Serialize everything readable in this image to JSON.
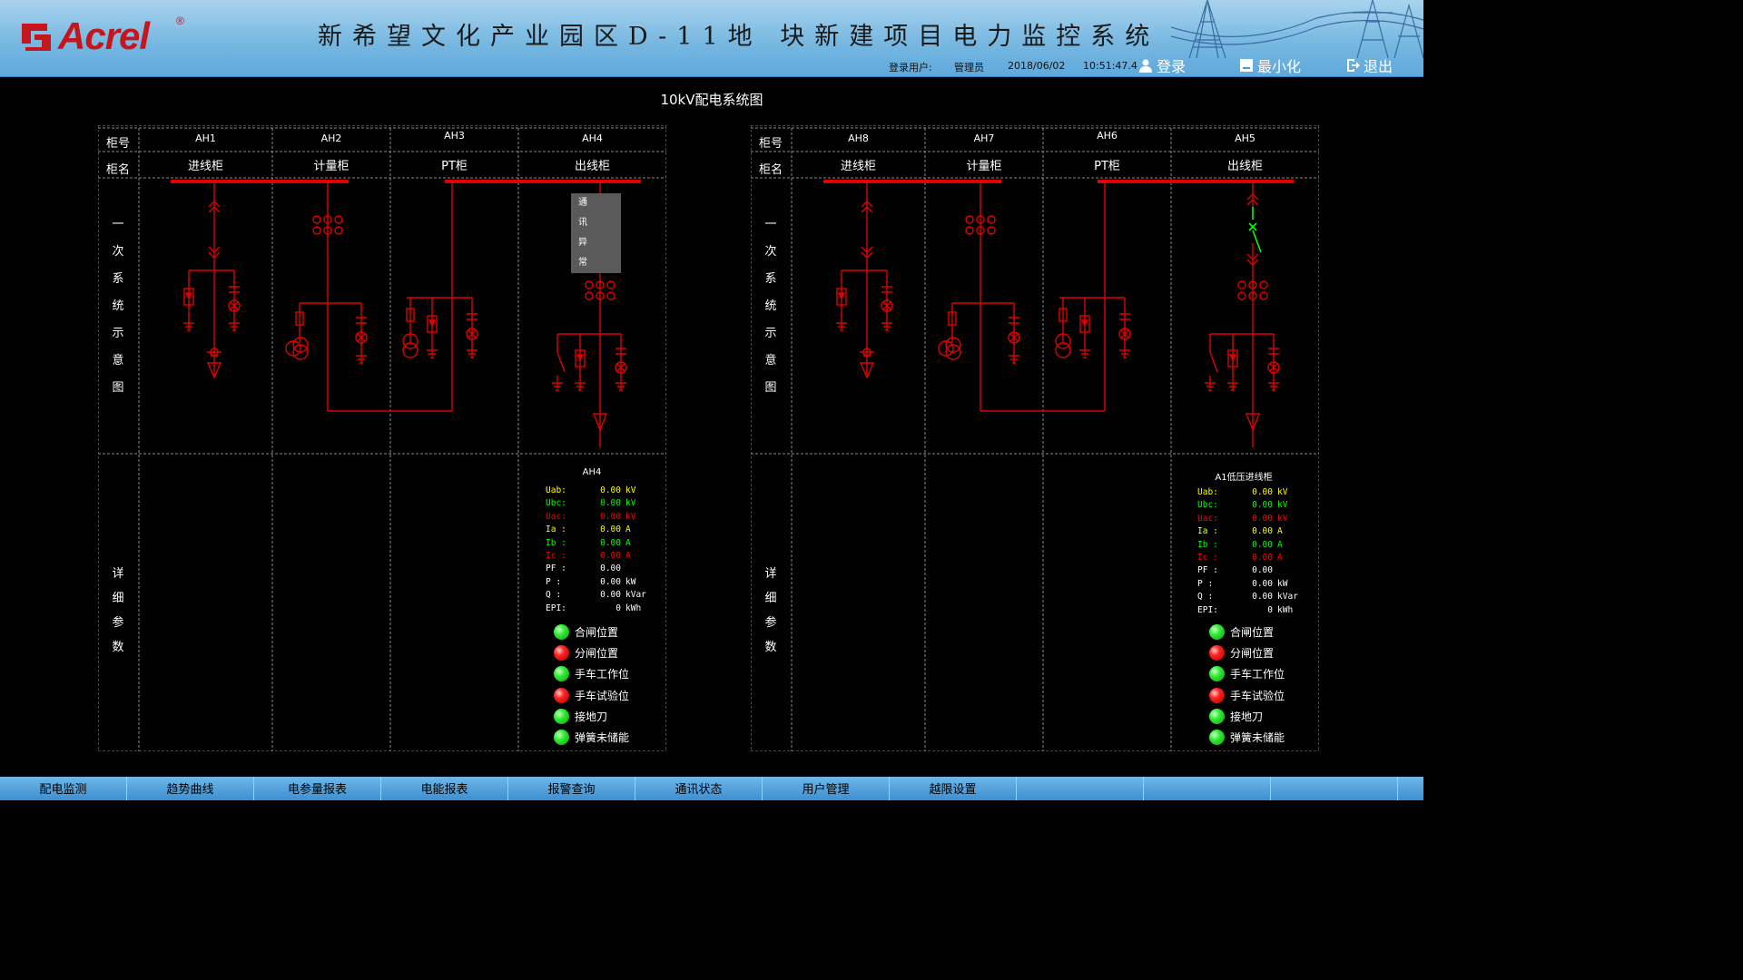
{
  "header": {
    "logo_text": "Acrel",
    "logo_reg": "®",
    "title": "新希望文化产业园区D-11地 块新建项目电力监控系统",
    "user_label": "登录用户:",
    "user_name": "管理员",
    "date": "2018/06/02",
    "time": "10:51:47.4",
    "login_label": "登录",
    "minimize_label": "最小化",
    "exit_label": "退出",
    "colors": {
      "bar_top": "#a9d3ee",
      "bar_bottom": "#5ea9dc",
      "logo": "#c4161c"
    }
  },
  "page_title": "10kV配电系统图",
  "row_labels": {
    "cabinet_no": "柜号",
    "cabinet_name": "柜名",
    "primary_lines": [
      "一",
      "次",
      "系",
      "统",
      "示",
      "意",
      "图"
    ],
    "details_lines": [
      "详",
      "细",
      "参",
      "数"
    ]
  },
  "panels": [
    {
      "cabinets": [
        {
          "no": "AH1",
          "name": "进线柜"
        },
        {
          "no": "AH2",
          "name": "计量柜"
        },
        {
          "no": "AH3",
          "name": "PT柜"
        },
        {
          "no": "AH4",
          "name": "出线柜"
        }
      ],
      "comm_status": [
        "通",
        "讯",
        "异",
        "常"
      ],
      "params_title": "AH4",
      "params": [
        {
          "key": "Uab:",
          "value": "0.00",
          "unit": "kV",
          "color": "#ffff00"
        },
        {
          "key": "Ubc:",
          "value": "0.00",
          "unit": "kV",
          "color": "#00ff00"
        },
        {
          "key": "Uac:",
          "value": "0.00",
          "unit": "kV",
          "color": "#ff0000"
        },
        {
          "key": "Ia :",
          "value": "0.00",
          "unit": "A",
          "color": "#ffff00"
        },
        {
          "key": "Ib :",
          "value": "0.00",
          "unit": "A",
          "color": "#00ff00"
        },
        {
          "key": "Ic :",
          "value": "0.00",
          "unit": "A",
          "color": "#ff0000"
        },
        {
          "key": "PF :",
          "value": "0.00",
          "unit": "",
          "color": "#ffffff"
        },
        {
          "key": "P  :",
          "value": "0.00",
          "unit": "kW",
          "color": "#ffffff"
        },
        {
          "key": "Q  :",
          "value": "0.00",
          "unit": "kVar",
          "color": "#ffffff"
        },
        {
          "key": "EPI:",
          "value": "0",
          "unit": "kWh",
          "color": "#ffffff"
        }
      ],
      "status": [
        {
          "label": "合闸位置",
          "state": "green"
        },
        {
          "label": "分闸位置",
          "state": "red"
        },
        {
          "label": "手车工作位",
          "state": "green"
        },
        {
          "label": "手车试验位",
          "state": "red"
        },
        {
          "label": "接地刀",
          "state": "green"
        },
        {
          "label": "弹簧未储能",
          "state": "green"
        }
      ]
    },
    {
      "cabinets": [
        {
          "no": "AH8",
          "name": "进线柜"
        },
        {
          "no": "AH7",
          "name": "计量柜"
        },
        {
          "no": "AH6",
          "name": "PT柜"
        },
        {
          "no": "AH5",
          "name": "出线柜"
        }
      ],
      "params_title": "A1低压进线柜",
      "params": [
        {
          "key": "Uab:",
          "value": "0.00",
          "unit": "kV",
          "color": "#ffff00"
        },
        {
          "key": "Ubc:",
          "value": "0.00",
          "unit": "kV",
          "color": "#00ff00"
        },
        {
          "key": "Uac:",
          "value": "0.00",
          "unit": "kV",
          "color": "#ff0000"
        },
        {
          "key": "Ia :",
          "value": "0.00",
          "unit": "A",
          "color": "#ffff00"
        },
        {
          "key": "Ib :",
          "value": "0.00",
          "unit": "A",
          "color": "#00ff00"
        },
        {
          "key": "Ic :",
          "value": "0.00",
          "unit": "A",
          "color": "#ff0000"
        },
        {
          "key": "PF :",
          "value": "0.00",
          "unit": "",
          "color": "#ffffff"
        },
        {
          "key": "P  :",
          "value": "0.00",
          "unit": "kW",
          "color": "#ffffff"
        },
        {
          "key": "Q  :",
          "value": "0.00",
          "unit": "kVar",
          "color": "#ffffff"
        },
        {
          "key": "EPI:",
          "value": "0",
          "unit": "kWh",
          "color": "#ffffff"
        }
      ],
      "status": [
        {
          "label": "合闸位置",
          "state": "green"
        },
        {
          "label": "分闸位置",
          "state": "red"
        },
        {
          "label": "手车工作位",
          "state": "green"
        },
        {
          "label": "手车试验位",
          "state": "red"
        },
        {
          "label": "接地刀",
          "state": "green"
        },
        {
          "label": "弹簧未储能",
          "state": "green"
        }
      ]
    }
  ],
  "nav": [
    "配电监测",
    "趋势曲线",
    "电参量报表",
    "电能报表",
    "报警查询",
    "通讯状态",
    "用户管理",
    "越限设置",
    "",
    "",
    ""
  ],
  "colors": {
    "wire": "#e00000",
    "closed_switch": "#00ff00",
    "grid": "#8a8a8a",
    "nav_bg": "#3d8fd0"
  }
}
